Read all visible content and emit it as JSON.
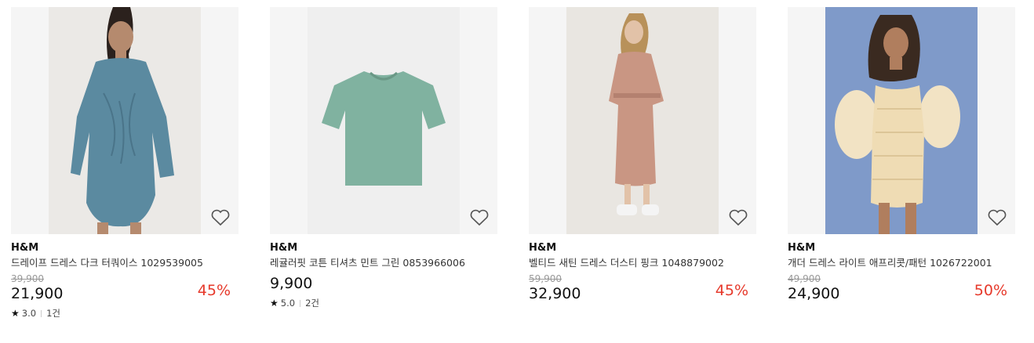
{
  "products": [
    {
      "brand": "H&M",
      "name": "드레이프 드레스 다크 터쿼이스 1029539005",
      "original_price": "39,900",
      "price": "21,900",
      "discount": "45%",
      "rating": "3.0",
      "review_count": "1건",
      "image": "turquoise-draped-dress-photo",
      "wishlist_icon": "heart-outline-icon"
    },
    {
      "brand": "H&M",
      "name": "레귤러핏 코튼 티셔츠 민트 그린 0853966006",
      "price": "9,900",
      "rating": "5.0",
      "review_count": "2건",
      "image": "mint-green-tshirt-photo",
      "wishlist_icon": "heart-outline-icon"
    },
    {
      "brand": "H&M",
      "name": "벨티드 새틴 드레스 더스티 핑크 1048879002",
      "original_price": "59,900",
      "price": "32,900",
      "discount": "45%",
      "image": "dusty-pink-satin-dress-photo",
      "wishlist_icon": "heart-outline-icon"
    },
    {
      "brand": "H&M",
      "name": "개더 드레스 라이트 애프리콧/패턴 1026722001",
      "original_price": "49,900",
      "price": "24,900",
      "discount": "50%",
      "image": "light-apricot-gathered-dress-photo",
      "wishlist_icon": "heart-outline-icon"
    }
  ],
  "colors": {
    "discount": "#e6392b",
    "strike_price": "#999999",
    "thumb_bg": "#f5f5f5"
  }
}
